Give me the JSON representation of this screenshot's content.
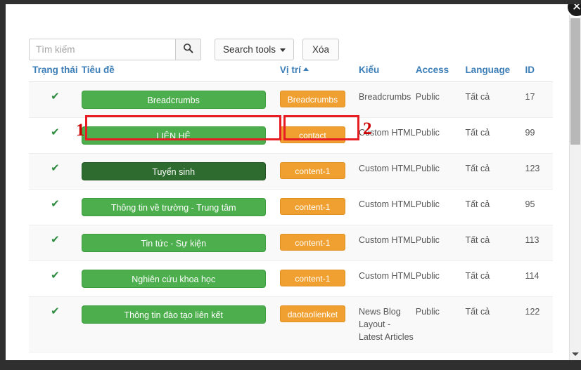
{
  "window": {
    "close_badge_icon": "close-icon",
    "close_badge_glyph": "✕"
  },
  "scrollbar": {
    "up_arrow_icon": "chevron-up-icon",
    "down_arrow_icon": "chevron-down-icon"
  },
  "toolbar": {
    "search_placeholder": "Tìm kiếm",
    "search_value": "",
    "search_icon": "search-icon",
    "search_tools_label": "Search tools",
    "search_tools_caret_icon": "caret-down-icon",
    "clear_label": "Xóa"
  },
  "table": {
    "headers": {
      "status": "Trạng thái",
      "title": "Tiêu đề",
      "position": "Vị trí",
      "position_sort_icon": "sort-ascending-icon",
      "type": "Kiểu",
      "access": "Access",
      "language": "Language",
      "id": "ID"
    },
    "rows": [
      {
        "status_icon": "check-icon",
        "status_glyph": "✔",
        "title": "Breadcrumbs",
        "position": "Breadcrumbs",
        "type": "Breadcrumbs",
        "access": "Public",
        "language": "Tất cả",
        "id": "17",
        "title_state": "normal"
      },
      {
        "status_icon": "check-icon",
        "status_glyph": "✔",
        "title": "LIÊN HỆ",
        "position": "contact",
        "type": "Custom HTML",
        "access": "Public",
        "language": "Tất cả",
        "id": "99",
        "title_state": "normal"
      },
      {
        "status_icon": "check-icon",
        "status_glyph": "✔",
        "title": "Tuyển sinh",
        "position": "content-1",
        "type": "Custom HTML",
        "access": "Public",
        "language": "Tất cả",
        "id": "123",
        "title_state": "hover"
      },
      {
        "status_icon": "check-icon",
        "status_glyph": "✔",
        "title": "Thông tin về trường - Trung tâm",
        "position": "content-1",
        "type": "Custom HTML",
        "access": "Public",
        "language": "Tất cả",
        "id": "95",
        "title_state": "normal"
      },
      {
        "status_icon": "check-icon",
        "status_glyph": "✔",
        "title": "Tin tức - Sự kiện",
        "position": "content-1",
        "type": "Custom HTML",
        "access": "Public",
        "language": "Tất cả",
        "id": "113",
        "title_state": "normal"
      },
      {
        "status_icon": "check-icon",
        "status_glyph": "✔",
        "title": "Nghiên cứu khoa học",
        "position": "content-1",
        "type": "Custom HTML",
        "access": "Public",
        "language": "Tất cả",
        "id": "114",
        "title_state": "normal"
      },
      {
        "status_icon": "check-icon",
        "status_glyph": "✔",
        "title": "Thông tin đào tạo liên kết",
        "position": "daotaolienket",
        "type": "News Blog Layout - Latest Articles",
        "access": "Public",
        "language": "Tất cả",
        "id": "122",
        "title_state": "normal"
      }
    ]
  },
  "annotations": [
    {
      "label": "1",
      "target": "title-pill-lien-he"
    },
    {
      "label": "2",
      "target": "position-pill-contact"
    }
  ],
  "colors": {
    "green_pill": "#4cae4c",
    "green_pill_hover": "#2d6b2f",
    "orange_pill": "#f0a030",
    "header_link": "#3c7eb8",
    "annotation_red": "#e81c23",
    "annotation_number": "#cc0000",
    "check_green": "#2f8d41"
  }
}
